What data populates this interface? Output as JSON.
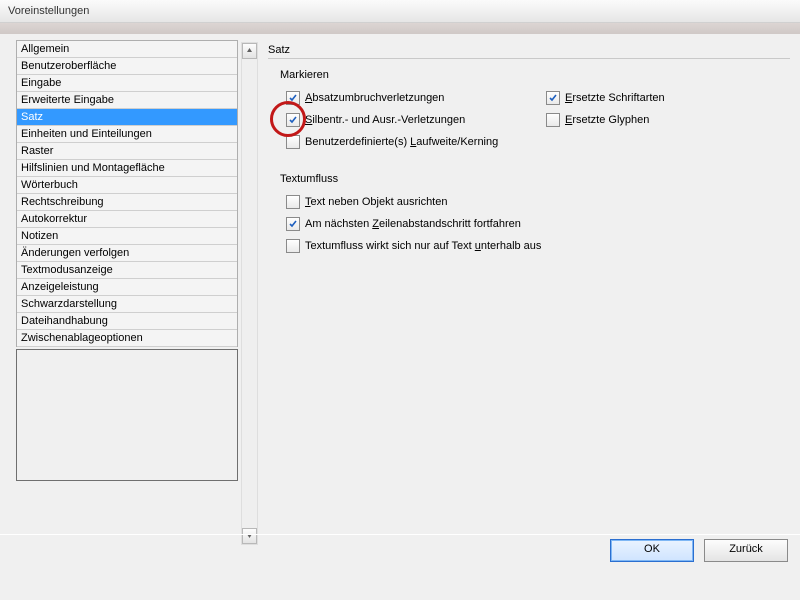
{
  "window": {
    "title": "Voreinstellungen"
  },
  "sidebar": {
    "items": [
      {
        "label": "Allgemein"
      },
      {
        "label": "Benutzeroberfläche"
      },
      {
        "label": "Eingabe"
      },
      {
        "label": "Erweiterte Eingabe"
      },
      {
        "label": "Satz",
        "selected": true
      },
      {
        "label": "Einheiten und Einteilungen"
      },
      {
        "label": "Raster"
      },
      {
        "label": "Hilfslinien und Montagefläche"
      },
      {
        "label": "Wörterbuch"
      },
      {
        "label": "Rechtschreibung"
      },
      {
        "label": "Autokorrektur"
      },
      {
        "label": "Notizen"
      },
      {
        "label": "Änderungen verfolgen"
      },
      {
        "label": "Textmodusanzeige"
      },
      {
        "label": "Anzeigeleistung"
      },
      {
        "label": "Schwarzdarstellung"
      },
      {
        "label": "Dateihandhabung"
      },
      {
        "label": "Zwischenablageoptionen"
      }
    ]
  },
  "main": {
    "title": "Satz",
    "group1": {
      "title": "Markieren",
      "opt1": {
        "pre": "",
        "u": "A",
        "post": "bsatzumbruchverletzungen",
        "checked": true
      },
      "opt2": {
        "pre": "",
        "u": "E",
        "post": "rsetzte Schriftarten",
        "checked": true
      },
      "opt3": {
        "pre": "",
        "u": "S",
        "post": "ilbentr.- und Ausr.-Verletzungen",
        "checked": true
      },
      "opt4": {
        "pre": "",
        "u": "E",
        "post": "rsetzte Glyphen",
        "checked": false
      },
      "opt5": {
        "pre": "Benutzerdefinierte(s) ",
        "u": "L",
        "post": "aufweite/Kerning",
        "checked": false
      }
    },
    "group2": {
      "title": "Textumfluss",
      "opt1": {
        "pre": "",
        "u": "T",
        "post": "ext neben Objekt ausrichten",
        "checked": false
      },
      "opt2": {
        "pre": "Am nächsten ",
        "u": "Z",
        "post": "eilenabstandschritt fortfahren",
        "checked": true
      },
      "opt3": {
        "pre": "Textumfluss wirkt sich nur auf Text ",
        "u": "u",
        "post": "nterhalb aus",
        "checked": false
      }
    }
  },
  "footer": {
    "ok": "OK",
    "back": "Zurück"
  }
}
